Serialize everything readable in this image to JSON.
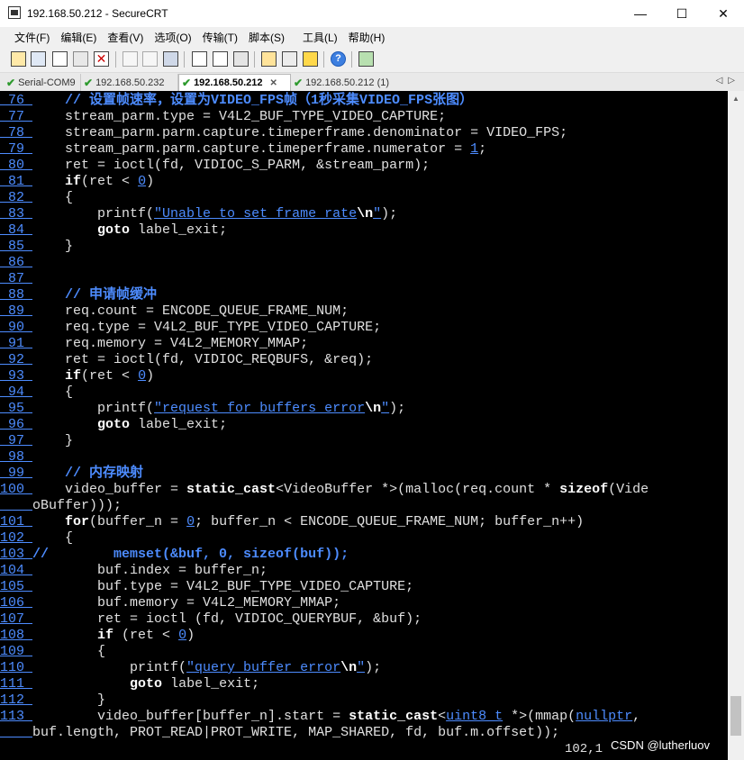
{
  "window": {
    "title": "192.168.50.212 - SecureCRT",
    "minimize": "—",
    "maximize": "☐",
    "close": "✕"
  },
  "menu": [
    "文件(F)",
    "编辑(E)",
    "查看(V)",
    "选项(O)",
    "传输(T)",
    "脚本(S)",
    "工具(L)",
    "帮助(H)"
  ],
  "tabs": [
    {
      "label": "Serial-COM9",
      "active": false
    },
    {
      "label": "192.168.50.232",
      "active": false
    },
    {
      "label": "192.168.50.212",
      "active": true
    },
    {
      "label": "192.168.50.212 (1)",
      "active": false
    }
  ],
  "tab_nav": "◁▷",
  "code_lines": [
    {
      "n": " 76 ",
      "segs": [
        [
          "",
          "    "
        ],
        [
          "cm",
          "// 设置帧速率，设置为VIDEO_FPS帧（1秒采集VIDEO_FPS张图）"
        ]
      ]
    },
    {
      "n": " 77 ",
      "segs": [
        [
          "",
          "    stream_parm.type = V4L2_BUF_TYPE_VIDEO_CAPTURE;"
        ]
      ]
    },
    {
      "n": " 78 ",
      "segs": [
        [
          "",
          "    stream_parm.parm.capture.timeperframe.denominator = VIDEO_FPS;"
        ]
      ]
    },
    {
      "n": " 79 ",
      "segs": [
        [
          "",
          "    stream_parm.parm.capture.timeperframe.numerator = "
        ],
        [
          "num",
          "1"
        ],
        [
          "",
          ";"
        ]
      ]
    },
    {
      "n": " 80 ",
      "segs": [
        [
          "",
          "    ret = ioctl(fd, VIDIOC_S_PARM, &stream_parm);"
        ]
      ]
    },
    {
      "n": " 81 ",
      "segs": [
        [
          "",
          "    "
        ],
        [
          "kw",
          "if"
        ],
        [
          "",
          "(ret < "
        ],
        [
          "num",
          "0"
        ],
        [
          "",
          ")"
        ]
      ]
    },
    {
      "n": " 82 ",
      "segs": [
        [
          "",
          "    {"
        ]
      ]
    },
    {
      "n": " 83 ",
      "segs": [
        [
          "",
          "        printf("
        ],
        [
          "str",
          "\"Unable to set frame rate"
        ],
        [
          "esc",
          "\\n"
        ],
        [
          "str",
          "\""
        ],
        [
          "",
          ");"
        ]
      ]
    },
    {
      "n": " 84 ",
      "segs": [
        [
          "",
          "        "
        ],
        [
          "kw",
          "goto"
        ],
        [
          "",
          " label_exit;"
        ]
      ]
    },
    {
      "n": " 85 ",
      "segs": [
        [
          "",
          "    }"
        ]
      ]
    },
    {
      "n": " 86 ",
      "segs": []
    },
    {
      "n": " 87 ",
      "segs": []
    },
    {
      "n": " 88 ",
      "segs": [
        [
          "",
          "    "
        ],
        [
          "cm",
          "// 申请帧缓冲"
        ]
      ]
    },
    {
      "n": " 89 ",
      "segs": [
        [
          "",
          "    req.count = ENCODE_QUEUE_FRAME_NUM;"
        ]
      ]
    },
    {
      "n": " 90 ",
      "segs": [
        [
          "",
          "    req.type = V4L2_BUF_TYPE_VIDEO_CAPTURE;"
        ]
      ]
    },
    {
      "n": " 91 ",
      "segs": [
        [
          "",
          "    req.memory = V4L2_MEMORY_MMAP;"
        ]
      ]
    },
    {
      "n": " 92 ",
      "segs": [
        [
          "",
          "    ret = ioctl(fd, VIDIOC_REQBUFS, &req);"
        ]
      ]
    },
    {
      "n": " 93 ",
      "segs": [
        [
          "",
          "    "
        ],
        [
          "kw",
          "if"
        ],
        [
          "",
          "(ret < "
        ],
        [
          "num",
          "0"
        ],
        [
          "",
          ")"
        ]
      ]
    },
    {
      "n": " 94 ",
      "segs": [
        [
          "",
          "    {"
        ]
      ]
    },
    {
      "n": " 95 ",
      "segs": [
        [
          "",
          "        printf("
        ],
        [
          "str",
          "\"request for buffers error"
        ],
        [
          "esc",
          "\\n"
        ],
        [
          "str",
          "\""
        ],
        [
          "",
          ");"
        ]
      ]
    },
    {
      "n": " 96 ",
      "segs": [
        [
          "",
          "        "
        ],
        [
          "kw",
          "goto"
        ],
        [
          "",
          " label_exit;"
        ]
      ]
    },
    {
      "n": " 97 ",
      "segs": [
        [
          "",
          "    }"
        ]
      ]
    },
    {
      "n": " 98 ",
      "segs": []
    },
    {
      "n": " 99 ",
      "segs": [
        [
          "",
          "    "
        ],
        [
          "cm",
          "// 内存映射"
        ]
      ]
    },
    {
      "n": "100 ",
      "segs": [
        [
          "",
          "    video_buffer = "
        ],
        [
          "kw",
          "static_cast"
        ],
        [
          "",
          "<VideoBuffer *>(malloc(req.count * "
        ],
        [
          "kw",
          "sizeof"
        ],
        [
          "",
          "(Vide"
        ]
      ]
    },
    {
      "n": "    ",
      "segs": [
        [
          "",
          "oBuffer)));"
        ]
      ]
    },
    {
      "n": "101 ",
      "segs": [
        [
          "",
          "    "
        ],
        [
          "kw",
          "for"
        ],
        [
          "",
          "(buffer_n = "
        ],
        [
          "num",
          "0"
        ],
        [
          "",
          "; buffer_n < ENCODE_QUEUE_FRAME_NUM; buffer_n++)"
        ]
      ]
    },
    {
      "n": "102 ",
      "segs": [
        [
          "",
          "    {"
        ]
      ]
    },
    {
      "n": "103 ",
      "segs": [
        [
          "cm",
          "//        memset(&buf, 0, sizeof(buf));"
        ]
      ]
    },
    {
      "n": "104 ",
      "segs": [
        [
          "",
          "        buf.index = buffer_n;"
        ]
      ]
    },
    {
      "n": "105 ",
      "segs": [
        [
          "",
          "        buf.type = V4L2_BUF_TYPE_VIDEO_CAPTURE;"
        ]
      ]
    },
    {
      "n": "106 ",
      "segs": [
        [
          "",
          "        buf.memory = V4L2_MEMORY_MMAP;"
        ]
      ]
    },
    {
      "n": "107 ",
      "segs": [
        [
          "",
          "        ret = ioctl (fd, VIDIOC_QUERYBUF, &buf);"
        ]
      ]
    },
    {
      "n": "108 ",
      "segs": [
        [
          "",
          "        "
        ],
        [
          "kw",
          "if"
        ],
        [
          "",
          " (ret < "
        ],
        [
          "num",
          "0"
        ],
        [
          "",
          ")"
        ]
      ]
    },
    {
      "n": "109 ",
      "segs": [
        [
          "",
          "        {"
        ]
      ]
    },
    {
      "n": "110 ",
      "segs": [
        [
          "",
          "            printf("
        ],
        [
          "str",
          "\"query buffer error"
        ],
        [
          "esc",
          "\\n"
        ],
        [
          "str",
          "\""
        ],
        [
          "",
          ");"
        ]
      ]
    },
    {
      "n": "111 ",
      "segs": [
        [
          "",
          "            "
        ],
        [
          "kw",
          "goto"
        ],
        [
          "",
          " label_exit;"
        ]
      ]
    },
    {
      "n": "112 ",
      "segs": [
        [
          "",
          "        }"
        ]
      ]
    },
    {
      "n": "113 ",
      "segs": [
        [
          "",
          "        video_buffer[buffer_n].start = "
        ],
        [
          "kw",
          "static_cast"
        ],
        [
          "",
          "<"
        ],
        [
          "typ",
          "uint8_t"
        ],
        [
          "",
          " *>(mmap("
        ],
        [
          "typ",
          "nullptr"
        ],
        [
          "",
          ","
        ]
      ]
    },
    {
      "n": "    ",
      "segs": [
        [
          "",
          "buf.length, PROT_READ|PROT_WRITE, MAP_SHARED, fd, buf.m.offset));"
        ]
      ]
    }
  ],
  "status_position": "102,1",
  "watermark": "CSDN @lutherluov"
}
